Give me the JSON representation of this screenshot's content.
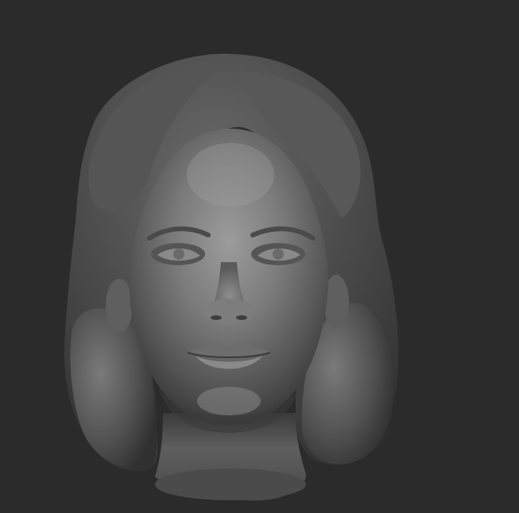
{
  "viewport": {
    "background": "#2b2b2b",
    "subject": "sculpt-head-bust"
  },
  "colors": {
    "clay_light": "#a8a8a8",
    "clay_mid": "#6f6f6f",
    "clay_dark": "#3c3c3c",
    "hair_base": "#4d4d4d",
    "hair_shadow": "#353535"
  }
}
